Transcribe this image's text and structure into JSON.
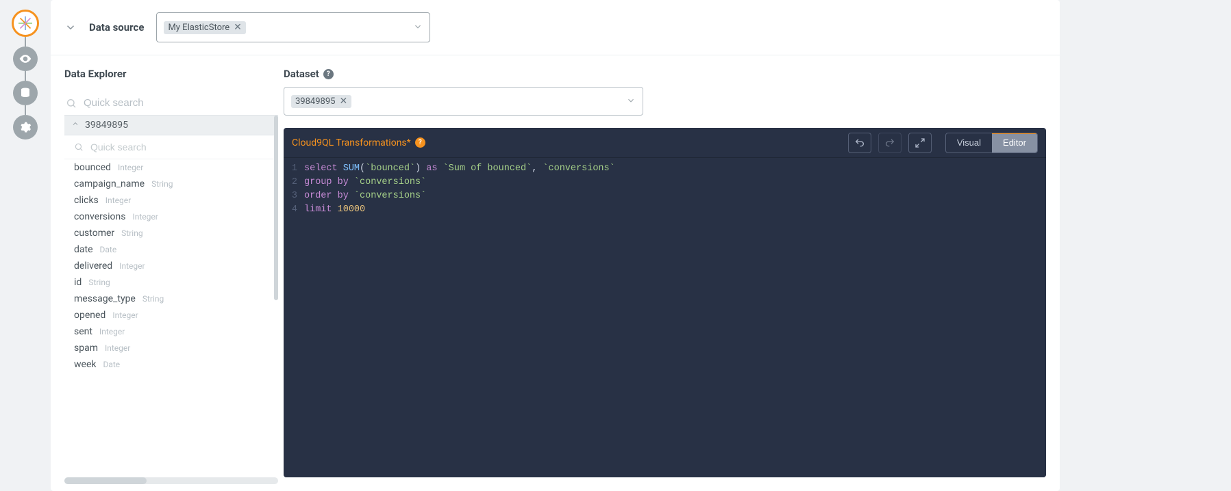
{
  "stepper": {
    "steps": [
      {
        "icon": "logo-icon",
        "active": true
      },
      {
        "icon": "eye-icon",
        "active": false
      },
      {
        "icon": "database-icon",
        "active": false
      },
      {
        "icon": "gear-icon",
        "active": false
      }
    ]
  },
  "datasource": {
    "section_label": "Data source",
    "selected_tag": "My ElasticStore"
  },
  "explorer": {
    "title": "Data Explorer",
    "quick_search_placeholder": "Quick search",
    "dataset_node": "39849895",
    "inner_search_placeholder": "Quick search",
    "fields": [
      {
        "name": "bounced",
        "type": "Integer"
      },
      {
        "name": "campaign_name",
        "type": "String"
      },
      {
        "name": "clicks",
        "type": "Integer"
      },
      {
        "name": "conversions",
        "type": "Integer"
      },
      {
        "name": "customer",
        "type": "String"
      },
      {
        "name": "date",
        "type": "Date"
      },
      {
        "name": "delivered",
        "type": "Integer"
      },
      {
        "name": "id",
        "type": "String"
      },
      {
        "name": "message_type",
        "type": "String"
      },
      {
        "name": "opened",
        "type": "Integer"
      },
      {
        "name": "sent",
        "type": "Integer"
      },
      {
        "name": "spam",
        "type": "Integer"
      },
      {
        "name": "week",
        "type": "Date"
      }
    ]
  },
  "dataset": {
    "section_label": "Dataset",
    "selected_tag": "39849895"
  },
  "editor": {
    "title": "Cloud9QL Transformations*",
    "tabs": {
      "visual": "Visual",
      "editor": "Editor",
      "active": "Editor"
    },
    "code_tokens": [
      [
        {
          "t": "select ",
          "c": "kw"
        },
        {
          "t": "SUM",
          "c": "fn"
        },
        {
          "t": "(",
          "c": "plain"
        },
        {
          "t": "`bounced`",
          "c": "str"
        },
        {
          "t": ") ",
          "c": "plain"
        },
        {
          "t": "as",
          "c": "kw"
        },
        {
          "t": " ",
          "c": "plain"
        },
        {
          "t": "`Sum of bounced`",
          "c": "str"
        },
        {
          "t": ", ",
          "c": "comma"
        },
        {
          "t": "`conversions`",
          "c": "str"
        }
      ],
      [
        {
          "t": "group by",
          "c": "kw"
        },
        {
          "t": " ",
          "c": "plain"
        },
        {
          "t": "`conversions`",
          "c": "str"
        }
      ],
      [
        {
          "t": "order by",
          "c": "kw"
        },
        {
          "t": " ",
          "c": "plain"
        },
        {
          "t": "`conversions`",
          "c": "str"
        }
      ],
      [
        {
          "t": "limit",
          "c": "kw"
        },
        {
          "t": " ",
          "c": "plain"
        },
        {
          "t": "10000",
          "c": "num"
        }
      ]
    ]
  }
}
